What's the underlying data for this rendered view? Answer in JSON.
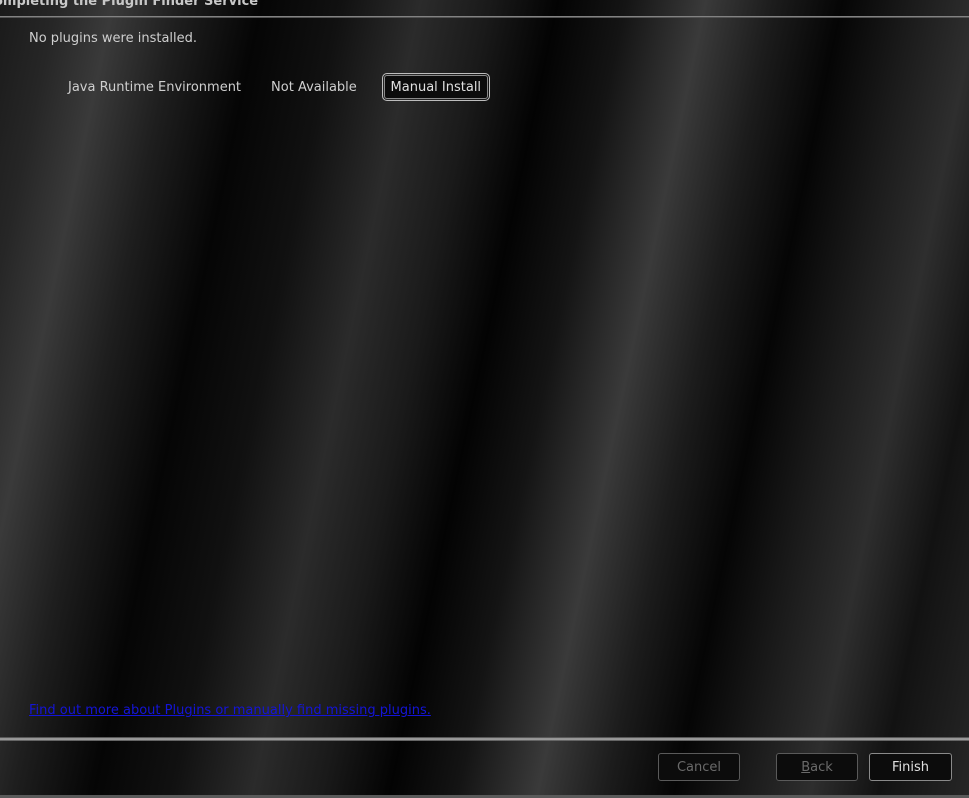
{
  "window": {
    "title": "ompleting the Plugin Finder Service"
  },
  "content": {
    "status_text": "No plugins were installed.",
    "plugins": [
      {
        "name": "Java Runtime Environment",
        "status": "Not Available",
        "action_label": "Manual Install"
      }
    ],
    "help_link": "Find out more about Plugins or manually find missing plugins."
  },
  "buttons": {
    "cancel": "Cancel",
    "back_mnemonic": "B",
    "back_rest": "ack",
    "finish": "Finish"
  },
  "colors": {
    "link": "#1414d8",
    "text": "#cfcfcf",
    "disabled_text": "#6a6a6a"
  }
}
